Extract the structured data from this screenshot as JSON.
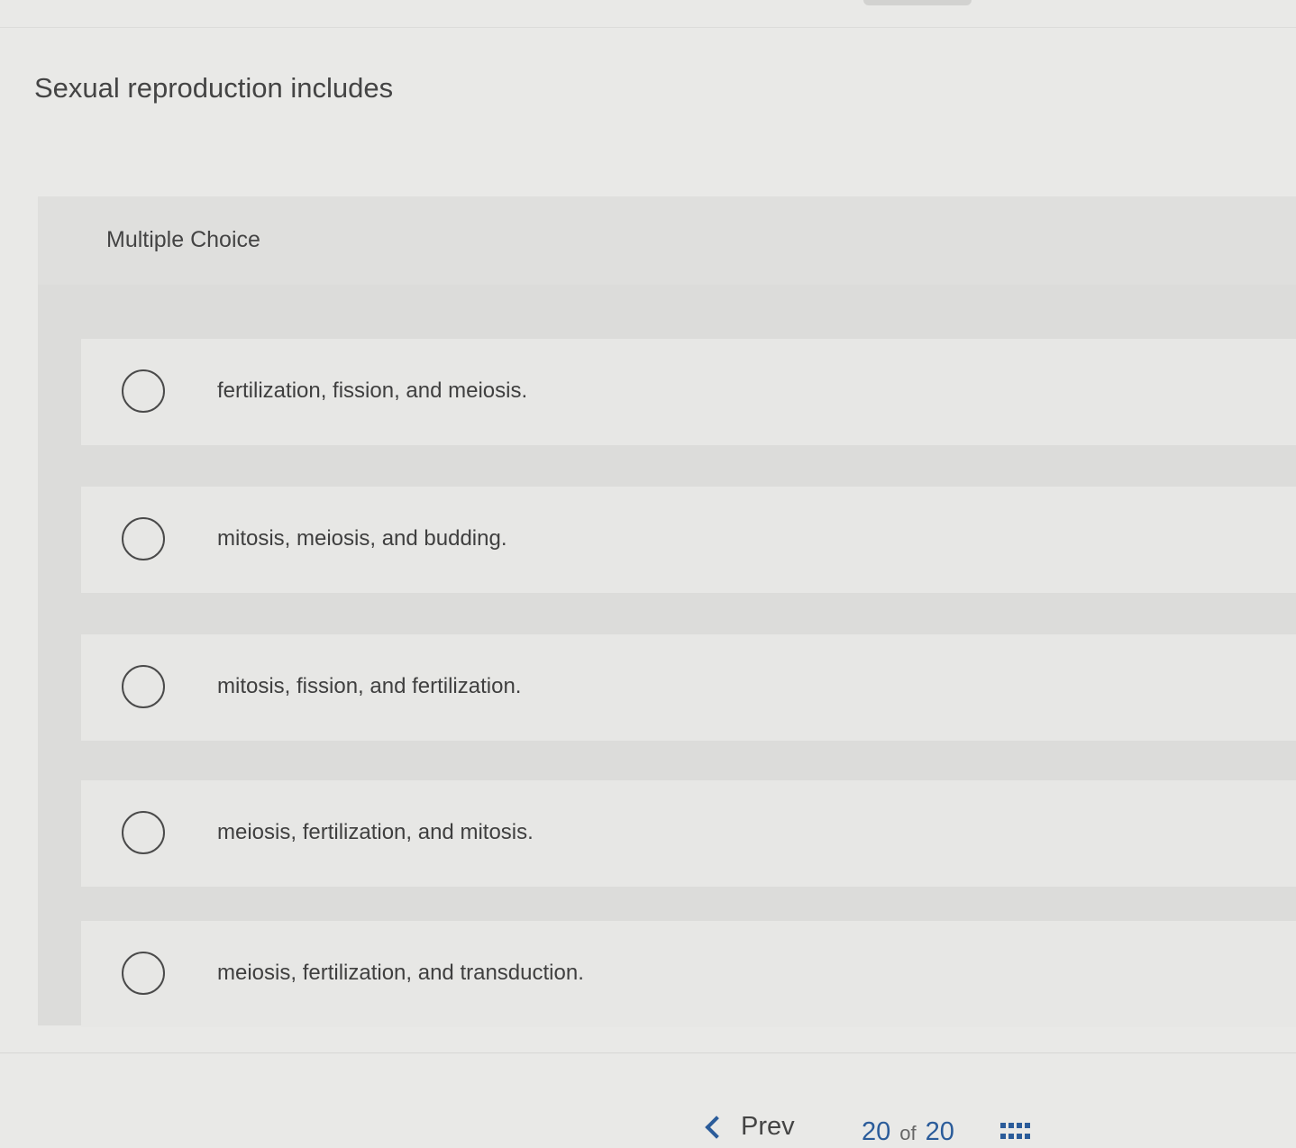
{
  "question": {
    "text": "Sexual reproduction includes"
  },
  "panel": {
    "label": "Multiple Choice",
    "options": [
      {
        "label": "fertilization, fission, and meiosis."
      },
      {
        "label": "mitosis, meiosis, and budding."
      },
      {
        "label": "mitosis, fission, and fertilization."
      },
      {
        "label": "meiosis, fertilization, and mitosis."
      },
      {
        "label": "meiosis, fertilization, and transduction."
      }
    ]
  },
  "pager": {
    "prev_label": "Prev",
    "current": "20",
    "of_label": "of",
    "total": "20"
  },
  "colors": {
    "accent": "#2b5c9a"
  }
}
